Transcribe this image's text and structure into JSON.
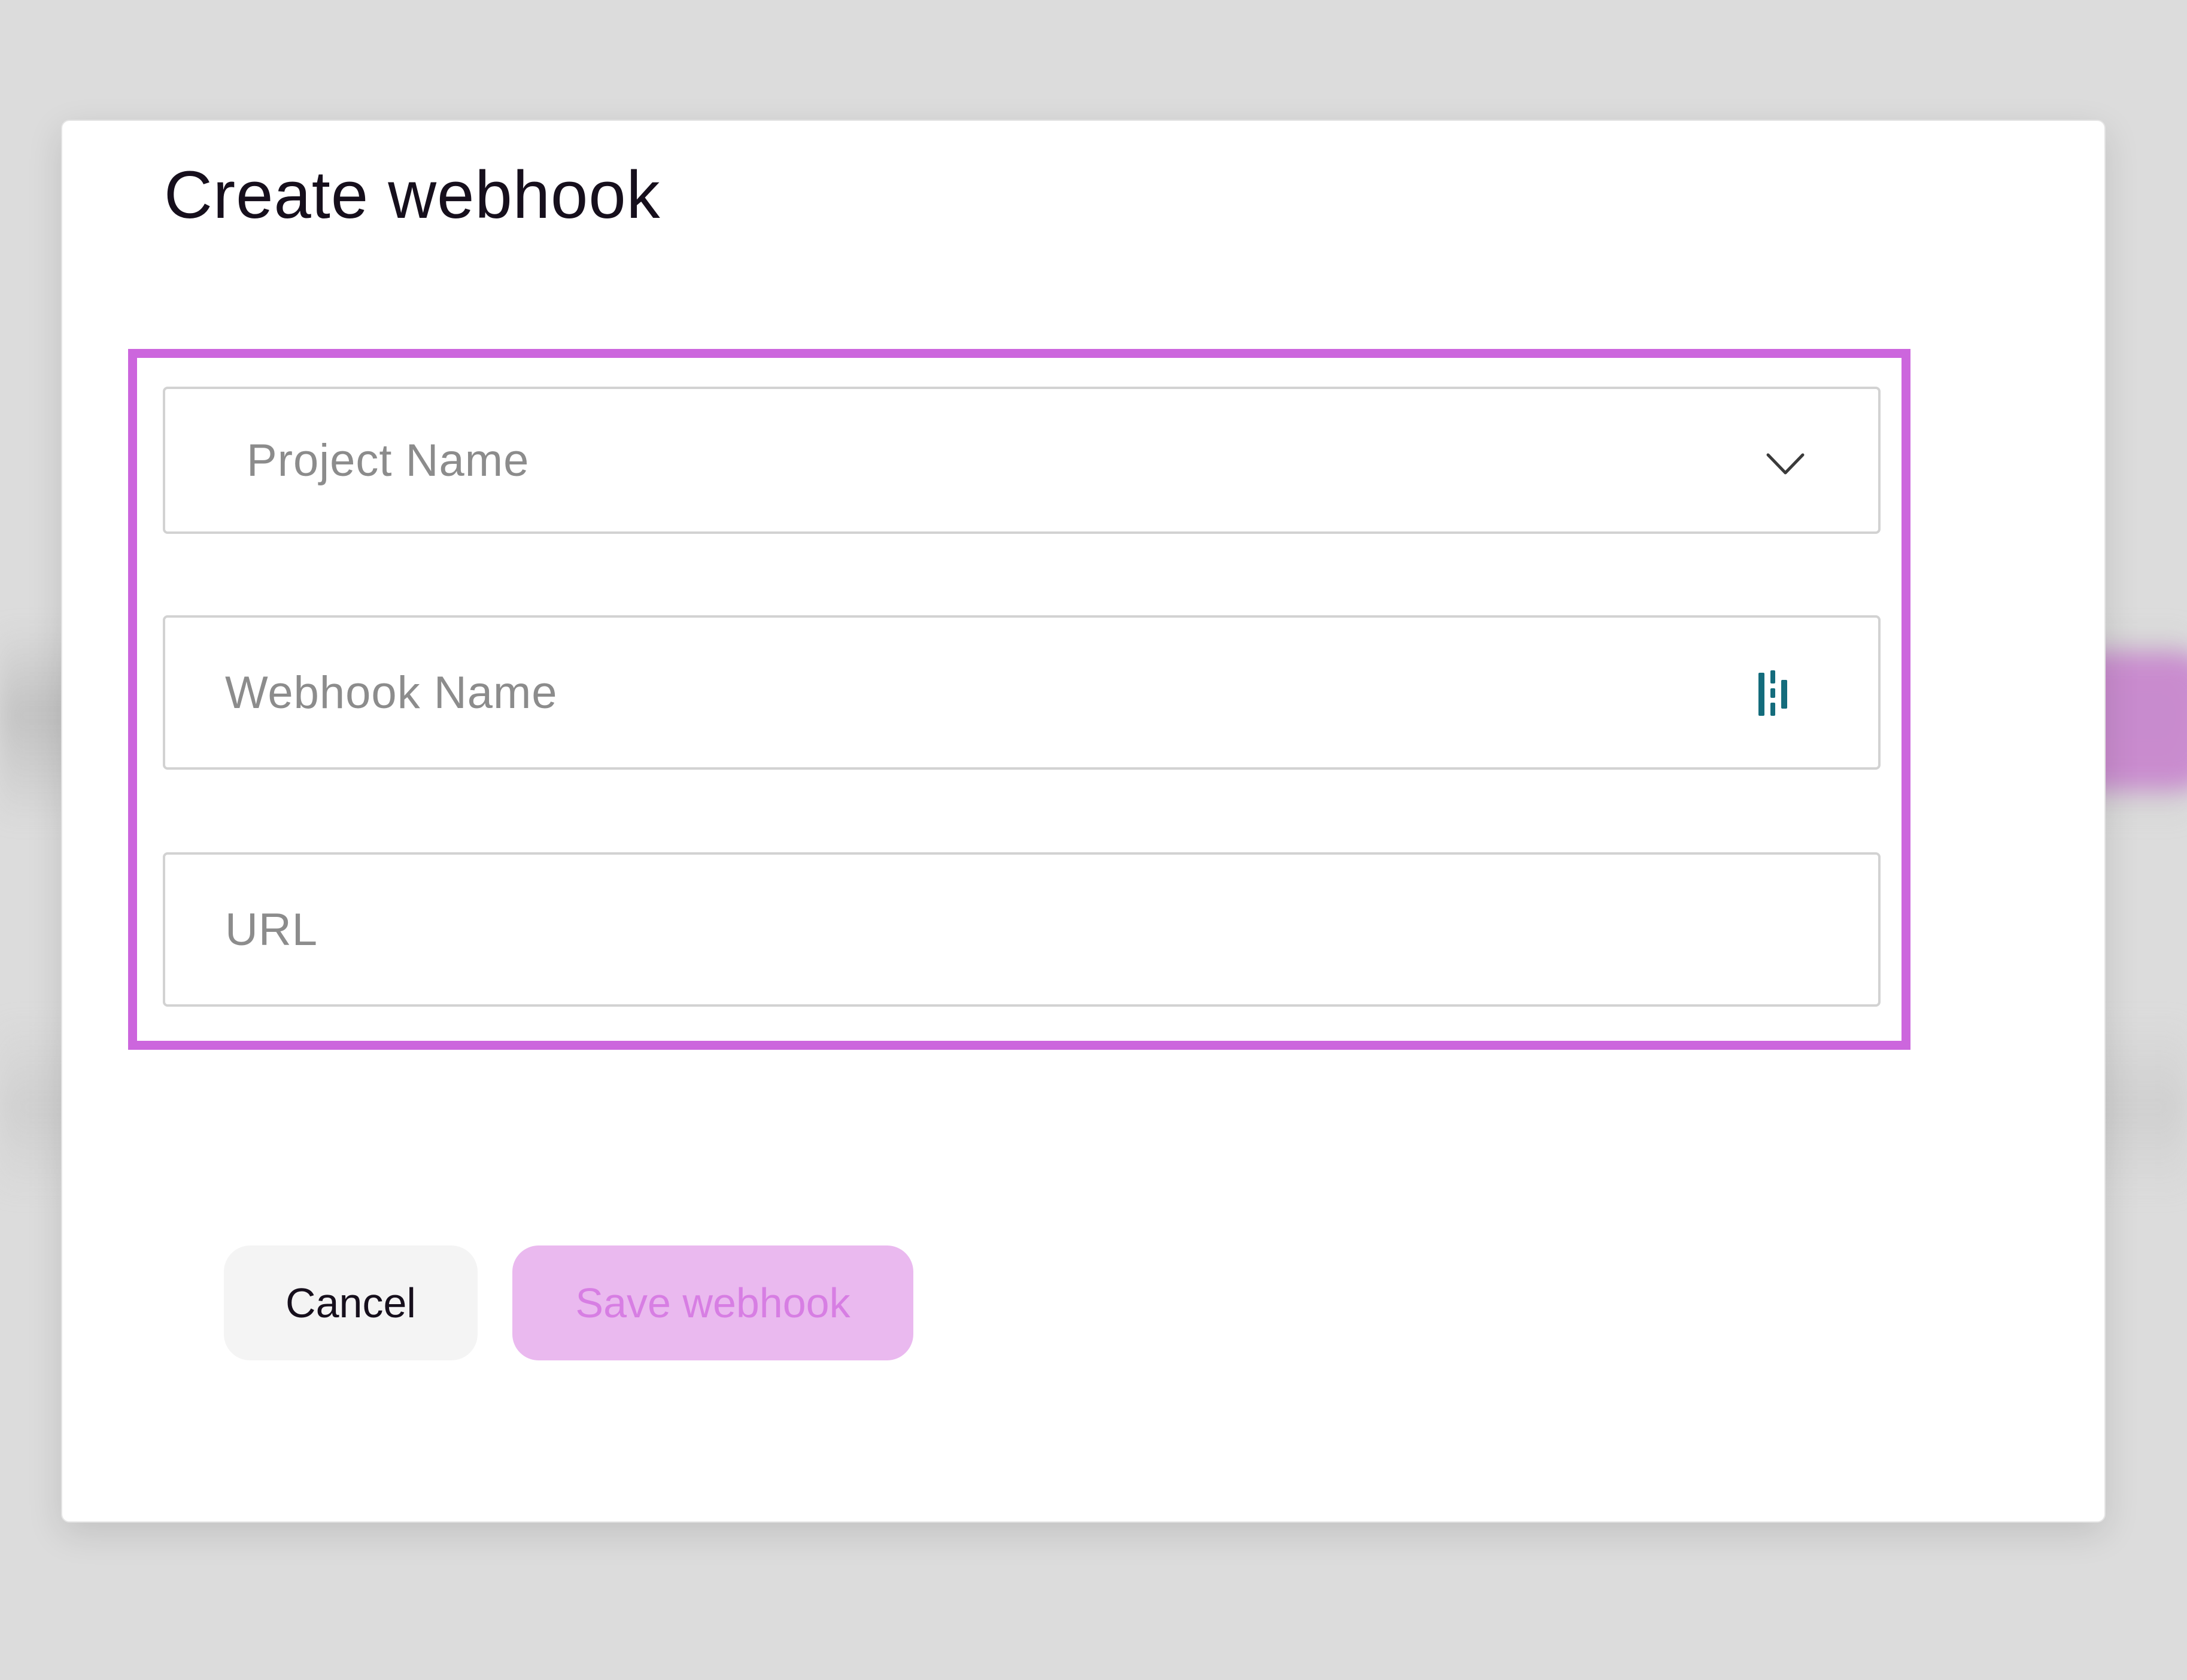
{
  "dialog": {
    "title": "Create webhook"
  },
  "form": {
    "project_name_placeholder": "Project Name",
    "webhook_name_placeholder": "Webhook Name",
    "url_placeholder": "URL"
  },
  "actions": {
    "cancel_label": "Cancel",
    "save_label": "Save webhook"
  },
  "icons": {
    "project_dropdown": "chevron-down-icon",
    "webhook_field_extension": "dashlane-icon"
  },
  "colors": {
    "highlight": "#cc66dd",
    "save_button_bg": "#eab9ef",
    "save_button_text": "#d77ee3",
    "title_text": "#160f1c",
    "extension_icon": "#146c7c"
  }
}
